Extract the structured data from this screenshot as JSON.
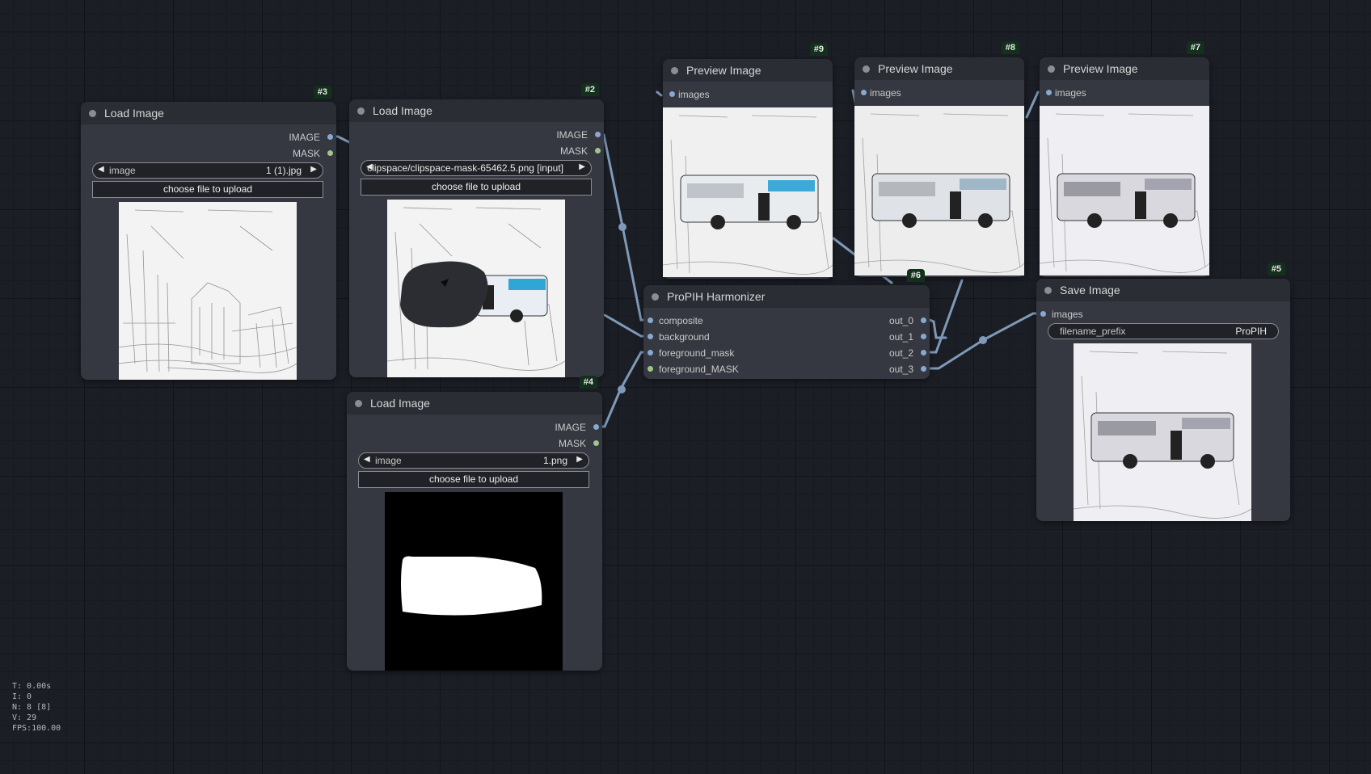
{
  "nodes": {
    "load3": {
      "badge": "#3",
      "title": "Load Image",
      "outputs": [
        "IMAGE",
        "MASK"
      ],
      "combo_label": "image",
      "combo_value": "1 (1).jpg",
      "upload_label": "choose file to upload"
    },
    "load2": {
      "badge": "#2",
      "title": "Load Image",
      "outputs": [
        "IMAGE",
        "MASK"
      ],
      "combo_value": "clipspace/clipspace-mask-65462.5.png [input]",
      "upload_label": "choose file to upload"
    },
    "load4": {
      "badge": "#4",
      "title": "Load Image",
      "outputs": [
        "IMAGE",
        "MASK"
      ],
      "combo_label": "image",
      "combo_value": "1.png",
      "upload_label": "choose file to upload"
    },
    "preview9": {
      "badge": "#9",
      "title": "Preview Image",
      "input": "images"
    },
    "preview8": {
      "badge": "#8",
      "title": "Preview Image",
      "input": "images"
    },
    "preview7": {
      "badge": "#7",
      "title": "Preview Image",
      "input": "images"
    },
    "propih": {
      "badge": "#6",
      "title": "ProPIH Harmonizer",
      "inputs": [
        "composite",
        "background",
        "foreground_mask",
        "foreground_MASK"
      ],
      "outputs": [
        "out_0",
        "out_1",
        "out_2",
        "out_3"
      ]
    },
    "save5": {
      "badge": "#5",
      "title": "Save Image",
      "input": "images",
      "field_label": "filename_prefix",
      "field_value": "ProPIH"
    }
  },
  "stats": [
    "T: 0.00s",
    "I: 0",
    "N: 8 [8]",
    "V: 29",
    "FPS:100.00"
  ],
  "colors": {
    "canvas": "#1b1e25",
    "node_body": "#353841",
    "node_header": "#2a2d34",
    "link": "#7f9ab8",
    "image_slot": "#88a8cf",
    "mask_slot": "#9fc58a",
    "badge": "#13301c"
  }
}
